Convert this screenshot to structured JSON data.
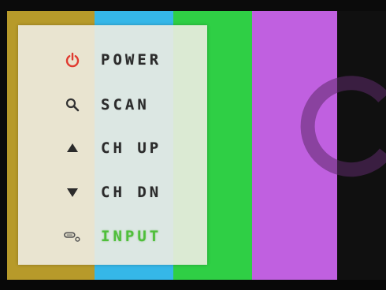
{
  "screen": {
    "color_bars": [
      "#b79a2a",
      "#35b7e8",
      "#2fcf45",
      "#c060e0",
      "#101010"
    ],
    "overlay_icon": "circular-logo-watermark",
    "overlay_color": "#5e2a6a"
  },
  "osd_menu": {
    "items": [
      {
        "label": "POWER",
        "icon": "power-icon",
        "icon_color": "#e03a2f",
        "active": false
      },
      {
        "label": "SCAN",
        "icon": "search-icon",
        "icon_color": "#333333",
        "active": false
      },
      {
        "label": "CH UP",
        "icon": "triangle-up-icon",
        "icon_color": "#2b2b2b",
        "active": false
      },
      {
        "label": "CH DN",
        "icon": "triangle-down-icon",
        "icon_color": "#2b2b2b",
        "active": false
      },
      {
        "label": "INPUT",
        "icon": "input-source-icon",
        "icon_color": "#555555",
        "active": true
      }
    ],
    "active_color": "#4fbf3a"
  }
}
